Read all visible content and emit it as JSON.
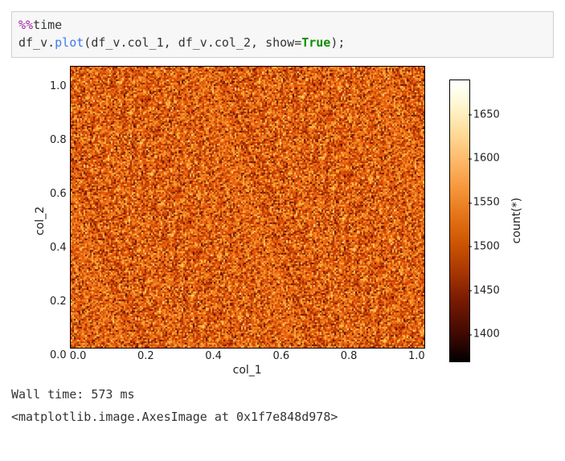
{
  "code": {
    "magic_pct": "%%",
    "magic_name": "time",
    "obj1": "df_v",
    "method": "plot",
    "arg1_obj": "df_v",
    "arg1_attr": "col_1",
    "arg2_obj": "df_v",
    "arg2_attr": "col_2",
    "kwarg_name": "show",
    "kwarg_val": "True",
    "semicolon": ";"
  },
  "chart_data": {
    "type": "heatmap",
    "title": "",
    "xlabel": "col_1",
    "ylabel": "col_2",
    "cbar_label": "count(*)",
    "xlim": [
      0.0,
      1.0
    ],
    "ylim": [
      0.0,
      1.0
    ],
    "xticks": [
      "0.0",
      "0.2",
      "0.4",
      "0.6",
      "0.8",
      "1.0"
    ],
    "yticks": [
      "0.0",
      "0.2",
      "0.4",
      "0.6",
      "0.8",
      "1.0"
    ],
    "cbar_range": [
      1370,
      1690
    ],
    "cbar_ticks": [
      1400,
      1450,
      1500,
      1550,
      1600,
      1650
    ],
    "description": "Dense uniform 2D density histogram of random uniform data over the unit square; bin counts roughly 1370–1690 per bin with no discernible spatial pattern.",
    "colormap": "afmhot"
  },
  "output": {
    "wall_time": "Wall time: 573 ms",
    "repr": "<matplotlib.image.AxesImage at 0x1f7e848d978>"
  }
}
